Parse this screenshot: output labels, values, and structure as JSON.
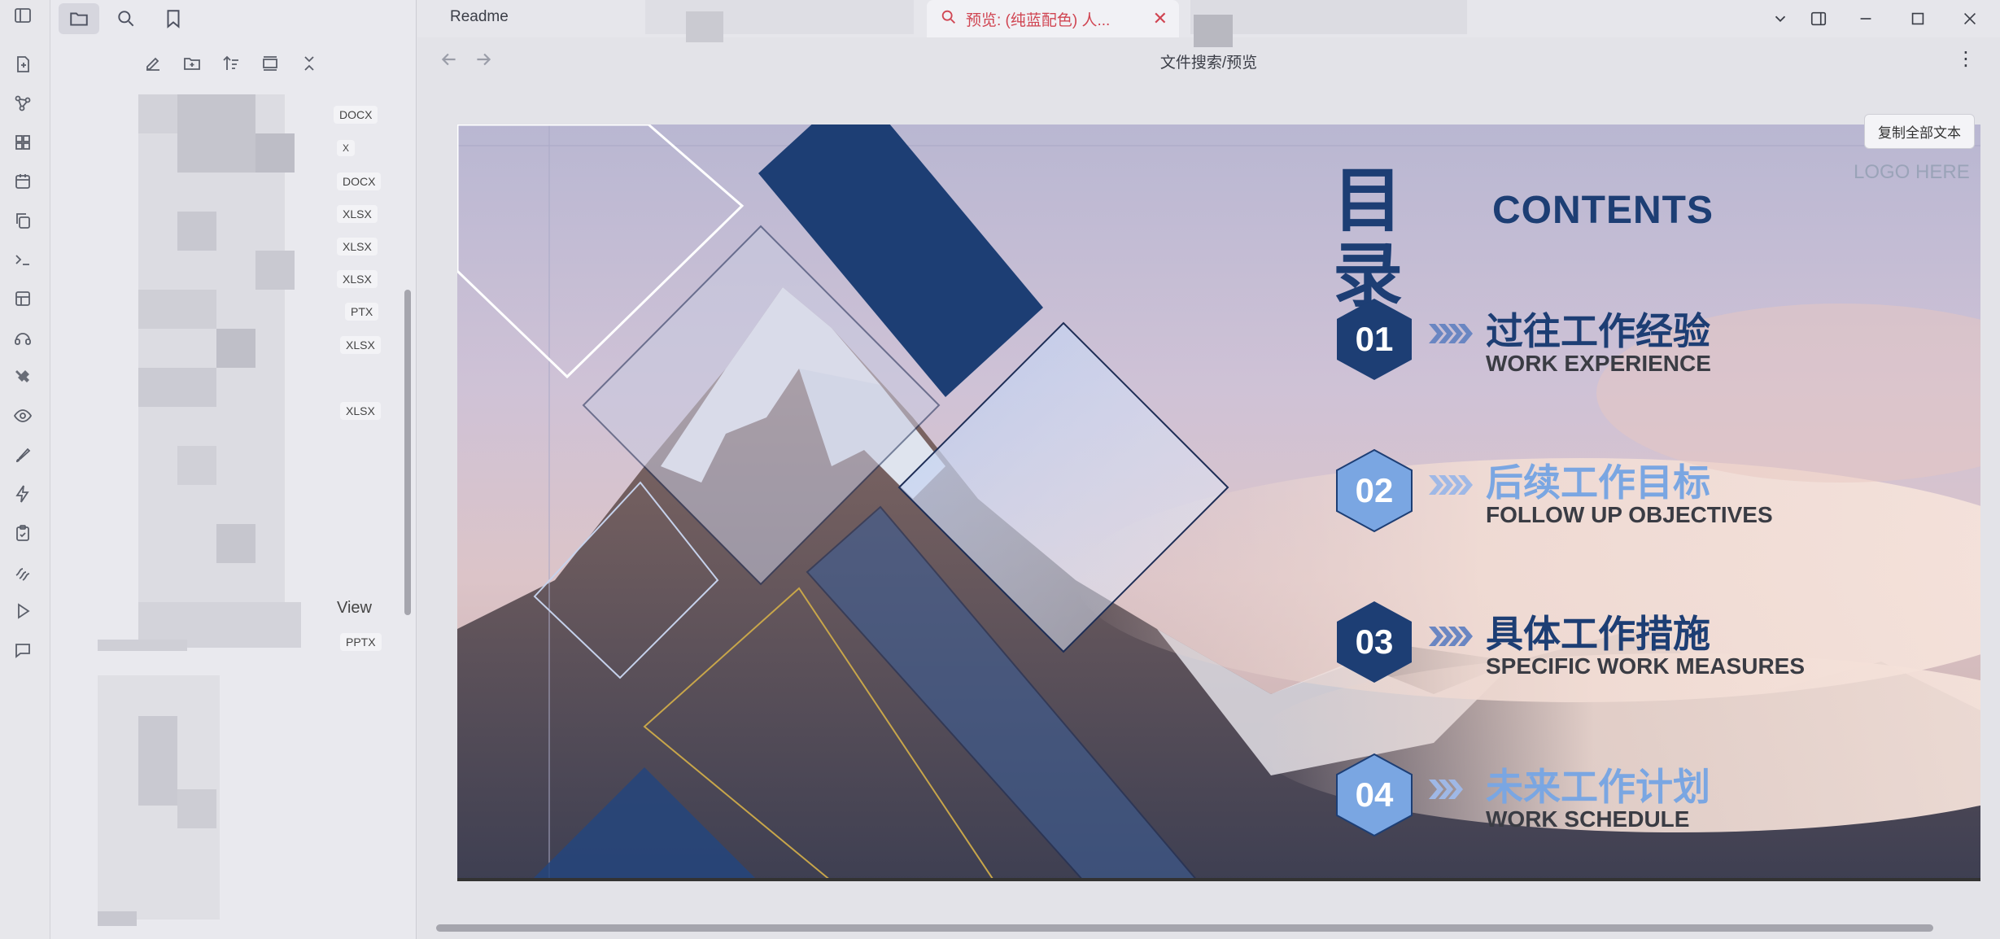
{
  "ribbon": {
    "icons": [
      "sidebar-toggle-icon",
      "new-note-icon",
      "graph-icon",
      "grid-icon",
      "calendar-icon",
      "copy-icon",
      "terminal-icon",
      "layout-icon",
      "headset-icon",
      "tools-icon",
      "eye-icon",
      "brush-icon",
      "lightning-icon",
      "clipboard-icon",
      "chain-icon",
      "play-icon",
      "comment-icon"
    ]
  },
  "sidebar": {
    "badges": [
      "DOCX",
      "X",
      "DOCX",
      "XLSX",
      "XLSX",
      "XLSX",
      "PTX",
      "XLSX",
      "XLSX",
      "PPTX"
    ],
    "view_label": "View"
  },
  "tabs": {
    "readme": "Readme",
    "search_tab": "预览: (纯蓝配色) 人...",
    "close": "✕"
  },
  "nav": {
    "title": "文件搜索/预览",
    "more": "⋮"
  },
  "slide": {
    "copy_button": "复制全部文本",
    "logo": "LOGO HERE",
    "mulu": "目录",
    "contents": "CONTENTS",
    "items": [
      {
        "num": "01",
        "cn": "过往工作经验",
        "en": "WORK EXPERIENCE"
      },
      {
        "num": "02",
        "cn": "后续工作目标",
        "en": "FOLLOW UP OBJECTIVES"
      },
      {
        "num": "03",
        "cn": "具体工作措施",
        "en": "SPECIFIC WORK MEASURES"
      },
      {
        "num": "04",
        "cn": "未来工作计划",
        "en": "WORK SCHEDULE"
      }
    ]
  },
  "colors": {
    "navy": "#1d3e74",
    "light_blue": "#7aa6e2",
    "accent_red": "#d04552"
  }
}
